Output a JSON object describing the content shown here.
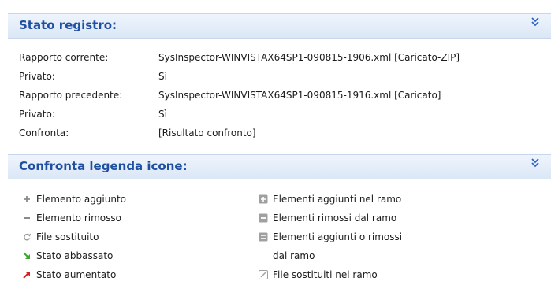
{
  "registry_section": {
    "title": "Stato registro:",
    "rows": [
      {
        "label": "Rapporto corrente:",
        "value": "SysInspector-WINVISTAX64SP1-090815-1906.xml [Caricato-ZIP]"
      },
      {
        "label": "Privato:",
        "value": "Sì"
      },
      {
        "label": "Rapporto precedente:",
        "value": "SysInspector-WINVISTAX64SP1-090815-1916.xml [Caricato]"
      },
      {
        "label": "Privato:",
        "value": "Sì"
      },
      {
        "label": "Confronta:",
        "value": "[Risultato confronto]"
      }
    ]
  },
  "legend_section": {
    "title": "Confronta legenda icone:",
    "left_items": [
      {
        "icon": "plus-icon",
        "label": "Elemento aggiunto"
      },
      {
        "icon": "minus-icon",
        "label": "Elemento rimosso"
      },
      {
        "icon": "replaced-file-icon",
        "label": "File sostituito"
      },
      {
        "icon": "arrow-down-green-icon",
        "label": "Stato abbassato"
      },
      {
        "icon": "arrow-up-red-icon",
        "label": "Stato aumentato"
      }
    ],
    "right_items": [
      {
        "icon": "branch-added-icon",
        "label": "Elementi aggiunti nel ramo"
      },
      {
        "icon": "branch-removed-icon",
        "label": "Elementi rimossi dal ramo"
      },
      {
        "icon": "branch-added-removed-icon",
        "label": "Elementi aggiunti o rimossi",
        "label_line2": "dal ramo"
      },
      {
        "icon": "branch-replaced-icon",
        "label": "File sostituiti nel ramo"
      }
    ]
  },
  "colors": {
    "header_text": "#1f4fa0",
    "header_bg": "#dbe7f6",
    "chevron": "#2d63c8",
    "arrow_down": "#3aa82d",
    "arrow_up": "#d42020"
  }
}
